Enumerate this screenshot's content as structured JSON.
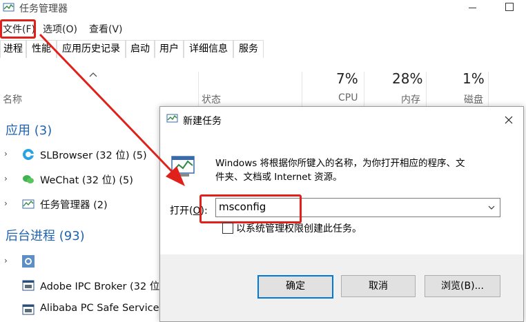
{
  "task_manager": {
    "title": "任务管理器",
    "menu": [
      "文件(F)",
      "选项(O)",
      "查看(V)"
    ],
    "tabs": [
      "进程",
      "性能",
      "应用历史记录",
      "启动",
      "用户",
      "详细信息",
      "服务"
    ],
    "columns": {
      "name": "名称",
      "status": "状态",
      "cpu": {
        "percent": "7%",
        "label": "CPU"
      },
      "memory": {
        "percent": "28%",
        "label": "内存"
      },
      "disk": {
        "percent": "1%",
        "label": "磁盘"
      }
    },
    "groups": {
      "apps": {
        "label": "应用 (3)",
        "items": [
          "SLBrowser (32 位) (5)",
          "WeChat (32 位) (5)",
          "任务管理器 (2)"
        ]
      },
      "background": {
        "label": "后台进程 (93)",
        "items": [
          "",
          "Adobe IPC Broker (32 位",
          "Alibaba PC Safe Service"
        ]
      }
    }
  },
  "run_dialog": {
    "title": "新建任务",
    "description_line1": "Windows 将根据你所键入的名称，为你打开相应的程序、文",
    "description_line2": "件夹、文档或 Internet 资源。",
    "open_label_prefix": "打开(",
    "open_label_key": "O",
    "open_label_suffix": "):",
    "input_value": "msconfig",
    "admin_checkbox_label": "以系统管理权限创建此任务。",
    "ok_label": "确定",
    "cancel_label": "取消",
    "browse_label": "浏览(B)..."
  },
  "colors": {
    "annotation_red": "#e0201b",
    "group_blue": "#1e63b0",
    "default_button_border": "#0078d7"
  }
}
